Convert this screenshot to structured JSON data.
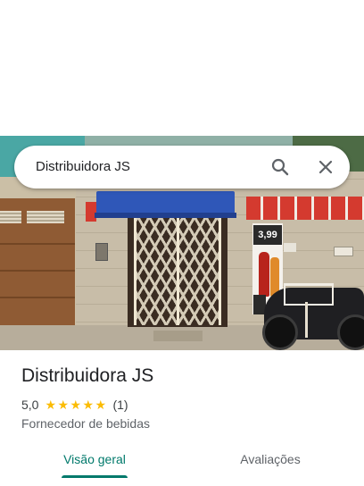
{
  "search": {
    "query": "Distribuidora JS",
    "search_icon": "search-icon",
    "close_icon": "close-icon"
  },
  "photo": {
    "price_sign_text": "3,99"
  },
  "place": {
    "name": "Distribuidora JS",
    "rating": "5,0",
    "stars": 5,
    "review_count": "(1)",
    "category": "Fornecedor de bebidas"
  },
  "tabs": [
    {
      "label": "Visão geral",
      "selected": true
    },
    {
      "label": "Avaliações",
      "selected": false
    }
  ],
  "colors": {
    "accent": "#00796b",
    "star": "#fbbc04",
    "text_primary": "#202124",
    "text_secondary": "#5f6368"
  }
}
